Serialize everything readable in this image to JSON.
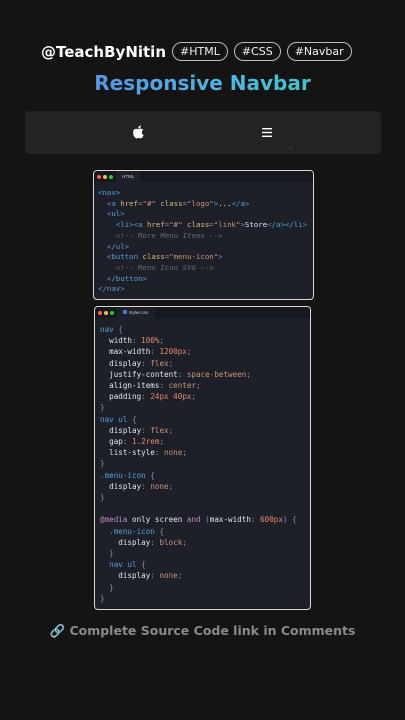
{
  "header": {
    "handle": "@TeachByNitin",
    "tags": [
      "#HTML",
      "#CSS",
      "#Navbar"
    ]
  },
  "title": "Responsive Navbar",
  "preview": {
    "logo_icon": "apple-icon",
    "menu_icon": "hamburger-menu-icon"
  },
  "html_window": {
    "tab_label": "HTML",
    "lines": [
      [
        [
          "tag",
          "<nav>"
        ]
      ],
      [
        [
          "txt",
          "  "
        ],
        [
          "tag",
          "<a "
        ],
        [
          "attr",
          "href"
        ],
        [
          "pun",
          "="
        ],
        [
          "str",
          "\"#\""
        ],
        [
          "txt",
          " "
        ],
        [
          "attr",
          "class"
        ],
        [
          "pun",
          "="
        ],
        [
          "str",
          "\"logo\""
        ],
        [
          "tag",
          ">"
        ],
        [
          "txt",
          "..."
        ],
        [
          "tag",
          "</a>"
        ]
      ],
      [
        [
          "txt",
          "  "
        ],
        [
          "tag",
          "<ul>"
        ]
      ],
      [
        [
          "txt",
          "    "
        ],
        [
          "tag",
          "<li><a "
        ],
        [
          "attr",
          "href"
        ],
        [
          "pun",
          "="
        ],
        [
          "str",
          "\"#\""
        ],
        [
          "txt",
          " "
        ],
        [
          "attr",
          "class"
        ],
        [
          "pun",
          "="
        ],
        [
          "str",
          "\"link\""
        ],
        [
          "tag",
          ">"
        ],
        [
          "txt",
          "Store"
        ],
        [
          "tag",
          "</a></li>"
        ]
      ],
      [
        [
          "txt",
          "    "
        ],
        [
          "com",
          "<!-- More Menu Items -->"
        ]
      ],
      [
        [
          "txt",
          "  "
        ],
        [
          "tag",
          "</ul>"
        ]
      ],
      [
        [
          "txt",
          "  "
        ],
        [
          "tag",
          "<button "
        ],
        [
          "attr",
          "class"
        ],
        [
          "pun",
          "="
        ],
        [
          "str",
          "\"menu-icon\""
        ],
        [
          "tag",
          ">"
        ]
      ],
      [
        [
          "txt",
          "    "
        ],
        [
          "com",
          "<!-- Menu Icon SVG -->"
        ]
      ],
      [
        [
          "txt",
          "  "
        ],
        [
          "tag",
          "</button>"
        ]
      ],
      [
        [
          "tag",
          "</nav>"
        ]
      ]
    ]
  },
  "css_window": {
    "tab_label": "styles.css",
    "lines": [
      [
        [
          "sel",
          "nav"
        ],
        [
          "pun",
          " {"
        ]
      ],
      [
        [
          "prop",
          "  width"
        ],
        [
          "pun",
          ": "
        ],
        [
          "num",
          "100%"
        ],
        [
          "pun",
          ";"
        ]
      ],
      [
        [
          "prop",
          "  max-width"
        ],
        [
          "pun",
          ": "
        ],
        [
          "num",
          "1200px"
        ],
        [
          "pun",
          ";"
        ]
      ],
      [
        [
          "prop",
          "  display"
        ],
        [
          "pun",
          ": "
        ],
        [
          "val",
          "flex"
        ],
        [
          "pun",
          ";"
        ]
      ],
      [
        [
          "prop",
          "  justify-content"
        ],
        [
          "pun",
          ": "
        ],
        [
          "val",
          "space-between"
        ],
        [
          "pun",
          ";"
        ]
      ],
      [
        [
          "prop",
          "  align-items"
        ],
        [
          "pun",
          ": "
        ],
        [
          "val",
          "center"
        ],
        [
          "pun",
          ";"
        ]
      ],
      [
        [
          "prop",
          "  padding"
        ],
        [
          "pun",
          ": "
        ],
        [
          "num",
          "24px 40px"
        ],
        [
          "pun",
          ";"
        ]
      ],
      [
        [
          "pun",
          "}"
        ]
      ],
      [
        [
          "sel",
          "nav ul"
        ],
        [
          "pun",
          " {"
        ]
      ],
      [
        [
          "prop",
          "  display"
        ],
        [
          "pun",
          ": "
        ],
        [
          "val",
          "flex"
        ],
        [
          "pun",
          ";"
        ]
      ],
      [
        [
          "prop",
          "  gap"
        ],
        [
          "pun",
          ": "
        ],
        [
          "num",
          "1.2rem"
        ],
        [
          "pun",
          ";"
        ]
      ],
      [
        [
          "prop",
          "  list-style"
        ],
        [
          "pun",
          ": "
        ],
        [
          "val",
          "none"
        ],
        [
          "pun",
          ";"
        ]
      ],
      [
        [
          "pun",
          "}"
        ]
      ],
      [
        [
          "sel",
          ".menu-icon"
        ],
        [
          "pun",
          " {"
        ]
      ],
      [
        [
          "prop",
          "  display"
        ],
        [
          "pun",
          ": "
        ],
        [
          "val",
          "none"
        ],
        [
          "pun",
          ";"
        ]
      ],
      [
        [
          "pun",
          "}"
        ]
      ],
      [
        [
          "txt",
          ""
        ]
      ],
      [
        [
          "kw",
          "@media"
        ],
        [
          "txt",
          " only screen "
        ],
        [
          "kw",
          "and"
        ],
        [
          "pun",
          " ("
        ],
        [
          "txt",
          "max-width"
        ],
        [
          "pun",
          ": "
        ],
        [
          "num",
          "600px"
        ],
        [
          "pun",
          ") {"
        ]
      ],
      [
        [
          "sel",
          "  .menu-icon"
        ],
        [
          "pun",
          " {"
        ]
      ],
      [
        [
          "prop",
          "    display"
        ],
        [
          "pun",
          ": "
        ],
        [
          "val",
          "block"
        ],
        [
          "pun",
          ";"
        ]
      ],
      [
        [
          "pun",
          "  }"
        ]
      ],
      [
        [
          "sel",
          "  nav ul"
        ],
        [
          "pun",
          " {"
        ]
      ],
      [
        [
          "prop",
          "    display"
        ],
        [
          "pun",
          ": "
        ],
        [
          "val",
          "none"
        ],
        [
          "pun",
          ";"
        ]
      ],
      [
        [
          "pun",
          "  }"
        ]
      ],
      [
        [
          "pun",
          "}"
        ]
      ]
    ]
  },
  "footer": "🔗 Complete Source Code link in Comments"
}
